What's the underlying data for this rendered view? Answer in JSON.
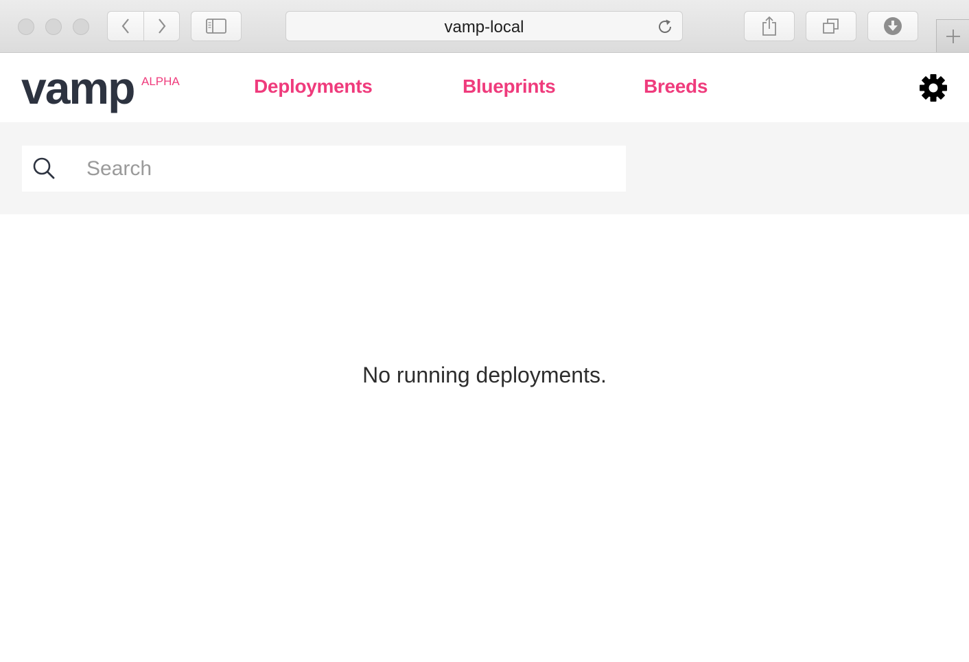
{
  "browser": {
    "url": "vamp-local"
  },
  "app": {
    "logo": "vamp",
    "badge": "ALPHA",
    "nav": [
      {
        "label": "Deployments"
      },
      {
        "label": "Blueprints"
      },
      {
        "label": "Breeds"
      }
    ]
  },
  "search": {
    "placeholder": "Search",
    "value": ""
  },
  "main": {
    "empty_message": "No running deployments."
  },
  "colors": {
    "accent": "#ef3b7c",
    "logo": "#2d3340",
    "search_band": "#f5f5f5"
  }
}
